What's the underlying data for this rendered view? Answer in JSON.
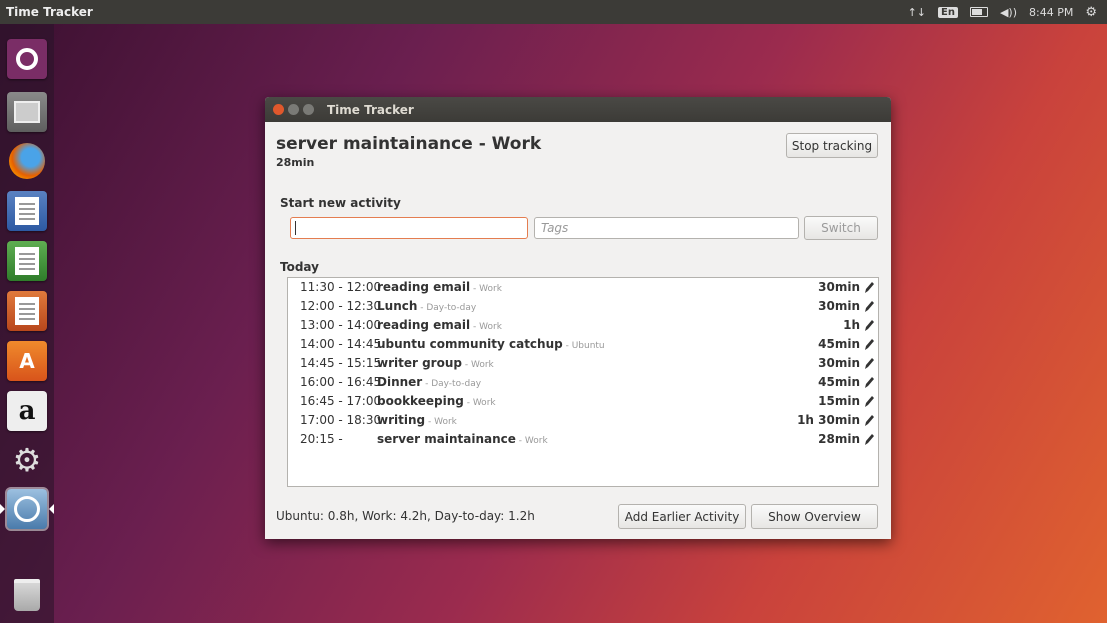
{
  "top_panel": {
    "app_title": "Time Tracker",
    "network_icon": "↑↓",
    "keyboard_layout": "En",
    "volume_icon": "◀))",
    "clock": "8:44 PM",
    "settings_icon": "⚙"
  },
  "launcher": {
    "items": [
      {
        "name": "ubuntu-logo-icon"
      },
      {
        "name": "files-icon"
      },
      {
        "name": "firefox-icon"
      },
      {
        "name": "libreoffice-writer-icon"
      },
      {
        "name": "libreoffice-calc-icon"
      },
      {
        "name": "libreoffice-impress-icon"
      },
      {
        "name": "software-center-icon",
        "glyph": "A"
      },
      {
        "name": "amazon-icon",
        "glyph": "a"
      },
      {
        "name": "system-settings-icon",
        "glyph": "⚙"
      },
      {
        "name": "time-tracker-icon"
      },
      {
        "name": "trash-icon"
      }
    ]
  },
  "window": {
    "title": "Time Tracker",
    "current": {
      "activity": "server maintainance - Work",
      "duration": "28min",
      "stop_label": "Stop tracking"
    },
    "start": {
      "label": "Start new activity",
      "activity_value": "",
      "tags_placeholder": "Tags",
      "switch_label": "Switch"
    },
    "today": {
      "label": "Today",
      "rows": [
        {
          "time": "11:30 - 12:00",
          "activity": "reading email",
          "category": " - Work",
          "duration": "30min"
        },
        {
          "time": "12:00 - 12:30",
          "activity": "Lunch",
          "category": " - Day-to-day",
          "duration": "30min"
        },
        {
          "time": "13:00 - 14:00",
          "activity": "reading email",
          "category": " - Work",
          "duration": "1h"
        },
        {
          "time": "14:00 - 14:45",
          "activity": "ubuntu community catchup",
          "category": " - Ubuntu",
          "duration": "45min"
        },
        {
          "time": "14:45 - 15:15",
          "activity": "writer group",
          "category": " - Work",
          "duration": "30min"
        },
        {
          "time": "16:00 - 16:45",
          "activity": "Dinner",
          "category": " - Day-to-day",
          "duration": "45min"
        },
        {
          "time": "16:45 - 17:00",
          "activity": "bookkeeping",
          "category": " - Work",
          "duration": "15min"
        },
        {
          "time": "17:00 - 18:30",
          "activity": "writing",
          "category": " - Work",
          "duration": "1h 30min"
        },
        {
          "time": "20:15 -",
          "activity": "server maintainance",
          "category": " - Work",
          "duration": "28min"
        }
      ]
    },
    "summary": "Ubuntu: 0.8h, Work: 4.2h, Day-to-day: 1.2h",
    "add_earlier_label": "Add Earlier Activity",
    "show_overview_label": "Show Overview"
  }
}
